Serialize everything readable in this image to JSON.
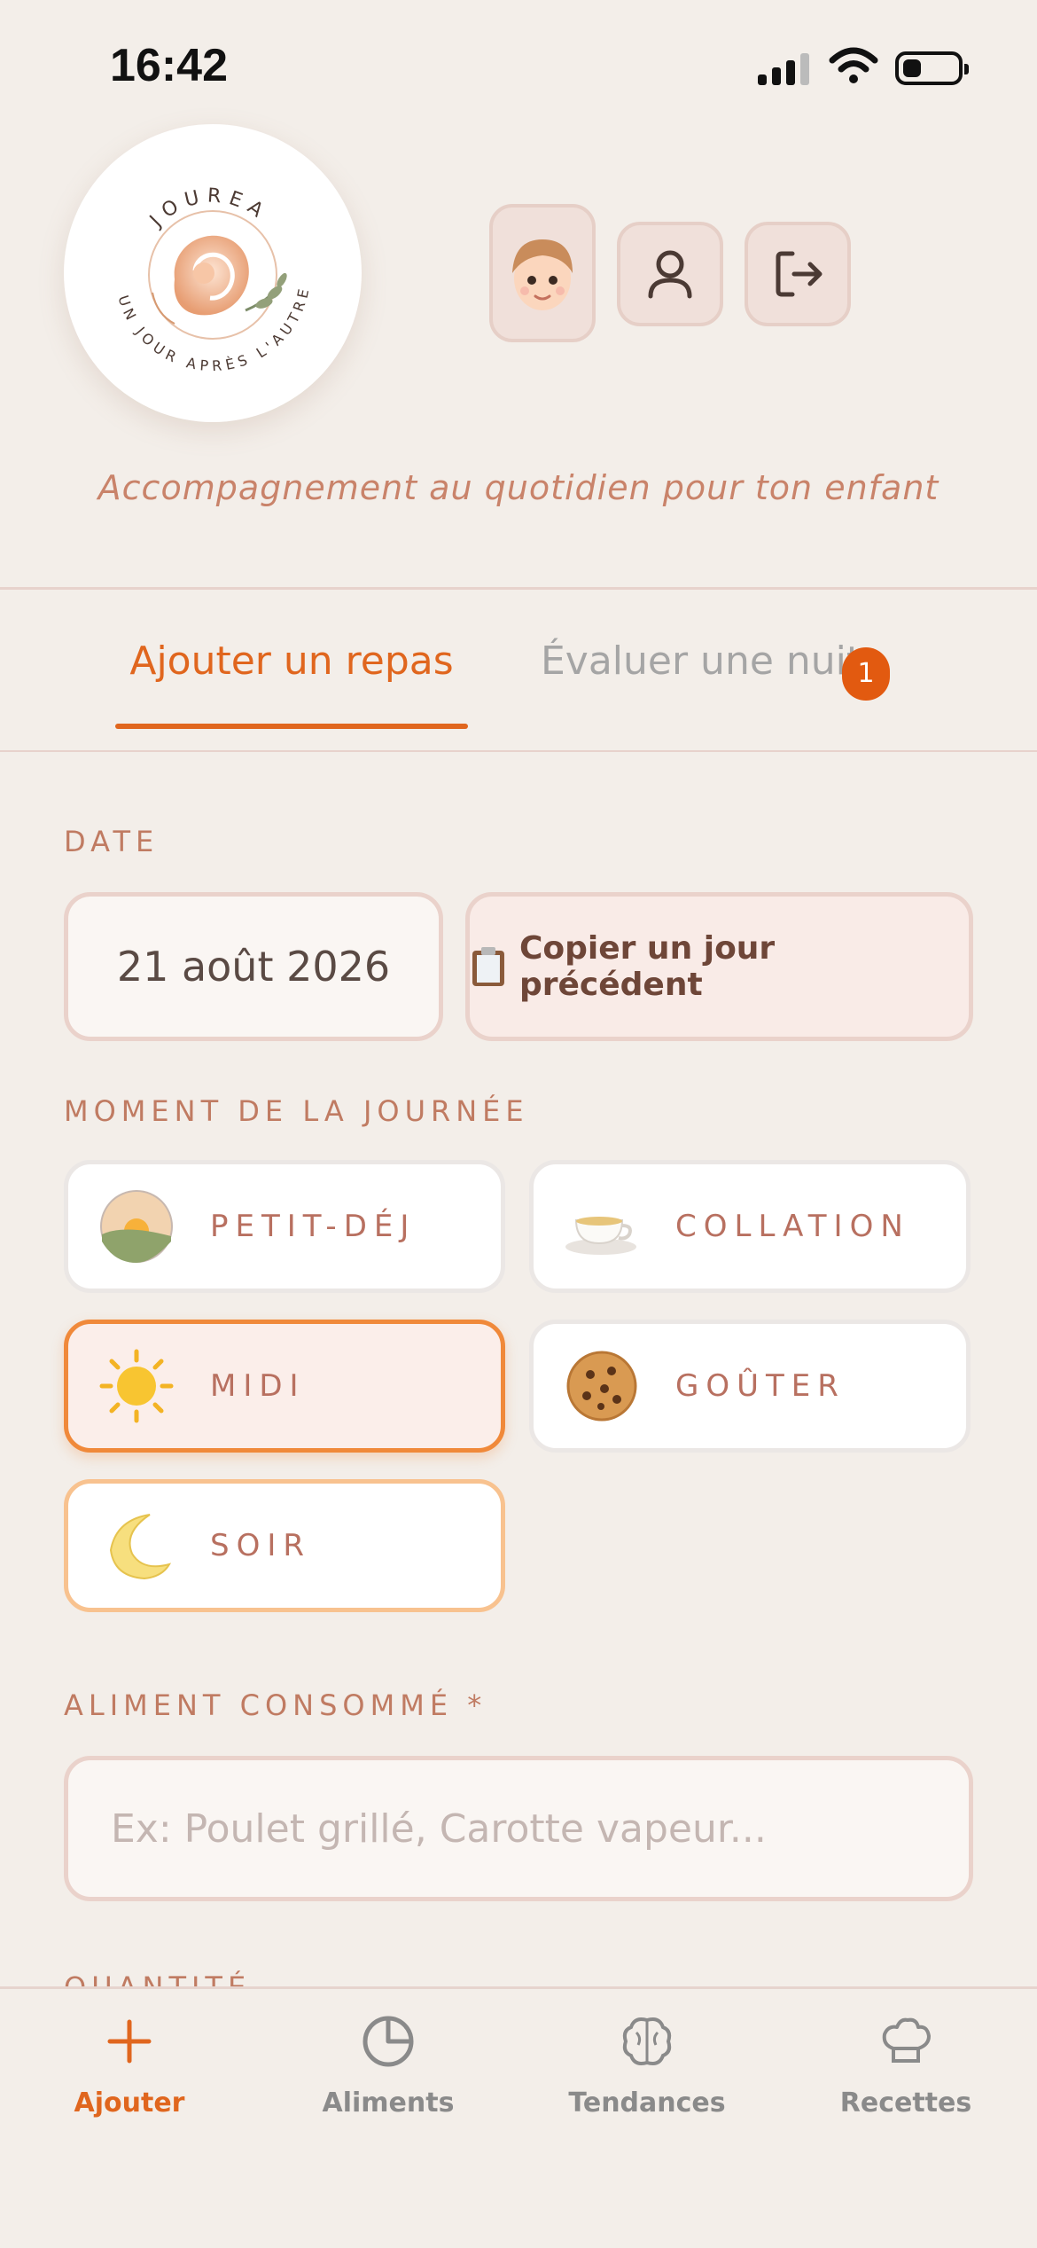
{
  "status_bar": {
    "time": "16:42"
  },
  "brand": {
    "name": "JOUREA",
    "slogan": "UN JOUR APRÈS L'AUTRE",
    "tagline": "Accompagnement au quotidien pour ton enfant"
  },
  "tabs": [
    {
      "label": "Ajouter un repas",
      "active": true
    },
    {
      "label": "Évaluer une nuit",
      "badge": "1",
      "active": false
    }
  ],
  "date_section": {
    "label": "DATE",
    "value": "21 août 2026",
    "copy_button": "Copier un jour précédent"
  },
  "moment_section": {
    "label": "MOMENT DE LA JOURNÉE",
    "options": [
      {
        "label": "PETIT-DÉJ",
        "icon": "sunrise-icon"
      },
      {
        "label": "COLLATION",
        "icon": "tea-cup-icon"
      },
      {
        "label": "MIDI",
        "icon": "sun-icon",
        "selected": true
      },
      {
        "label": "GOÛTER",
        "icon": "cookie-icon"
      },
      {
        "label": "SOIR",
        "icon": "moon-icon"
      }
    ]
  },
  "food_section": {
    "label": "ALIMENT CONSOMMÉ *",
    "placeholder": "Ex: Poulet grillé, Carotte vapeur..."
  },
  "quantity_section": {
    "label": "QUANTITÉ"
  },
  "bottom_nav": [
    {
      "label": "Ajouter",
      "icon": "plus-icon",
      "active": true
    },
    {
      "label": "Aliments",
      "icon": "pie-chart-icon"
    },
    {
      "label": "Tendances",
      "icon": "brain-icon"
    },
    {
      "label": "Recettes",
      "icon": "chef-hat-icon"
    }
  ],
  "colors": {
    "accent": "#e0661e",
    "background": "#f3eee9",
    "label": "#c07b62"
  }
}
